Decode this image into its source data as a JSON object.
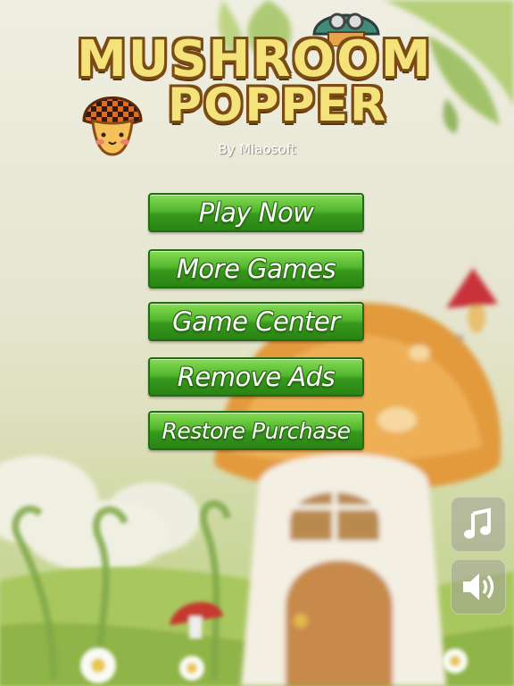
{
  "title": {
    "line1": "MUSHROOM",
    "line2": "POPPER"
  },
  "byline": "By Miaosoft",
  "menu": [
    {
      "label": "Play Now"
    },
    {
      "label": "More Games"
    },
    {
      "label": "Game Center"
    },
    {
      "label": "Remove Ads"
    },
    {
      "label": "Restore Purchase"
    }
  ],
  "controls": {
    "music_icon": "music-note-icon",
    "sound_icon": "speaker-icon"
  },
  "colors": {
    "button_green": "#3fa322",
    "title_yellow": "#f3e37a",
    "title_outline": "#7a4b12",
    "mushroom_orange": "#e8a040"
  }
}
